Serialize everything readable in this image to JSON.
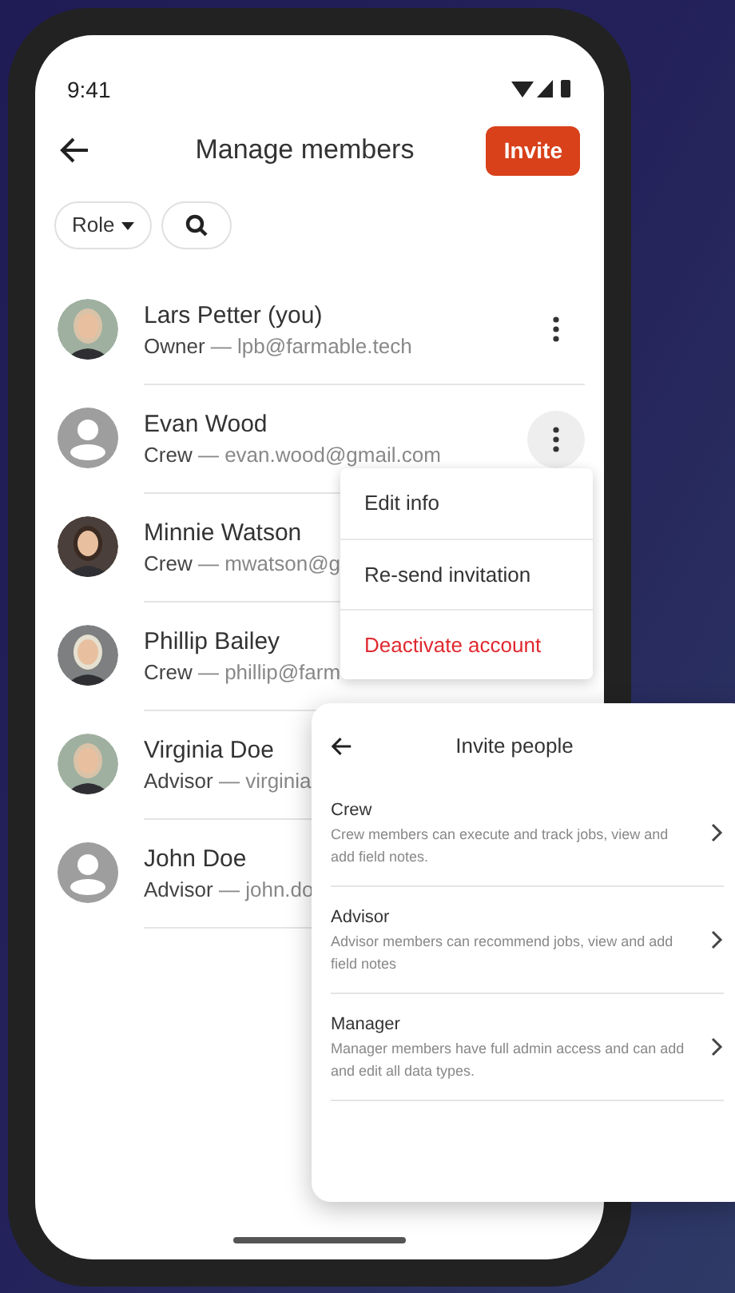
{
  "status_bar": {
    "time": "9:41"
  },
  "header": {
    "title": "Manage members",
    "invite_button": "Invite"
  },
  "filters": {
    "role_chip": "Role"
  },
  "members": [
    {
      "name": "Lars Petter (you)",
      "role": "Owner",
      "email": "— lpb@farmable.tech",
      "menu_open": false
    },
    {
      "name": "Evan Wood",
      "role": "Crew",
      "email": "— evan.wood@gmail.com",
      "kind": "placeholder",
      "menu_open": true
    },
    {
      "name": "Minnie Watson",
      "role": "Crew",
      "email": "— mwatson@g"
    },
    {
      "name": "Phillip Bailey",
      "role": "Crew",
      "email": "— phillip@farm"
    },
    {
      "name": "Virginia Doe",
      "role": "Advisor",
      "email": "— virginia"
    },
    {
      "name": "John Doe",
      "role": "Advisor",
      "email": "— john.do",
      "kind": "placeholder"
    }
  ],
  "menu": [
    {
      "label": "Edit info",
      "kind": "normal"
    },
    {
      "label": "Re-send invitation",
      "kind": "normal"
    },
    {
      "label": "Deactivate account",
      "kind": "danger"
    }
  ],
  "invite_panel": {
    "title": "Invite people",
    "options": [
      {
        "title": "Crew",
        "description": "Crew members can execute and track jobs, view and add field notes."
      },
      {
        "title": "Advisor",
        "description": "Advisor members can recommend jobs, view and add field notes"
      },
      {
        "title": "Manager",
        "description": "Manager members have full admin access and can add and edit all data types."
      }
    ]
  }
}
